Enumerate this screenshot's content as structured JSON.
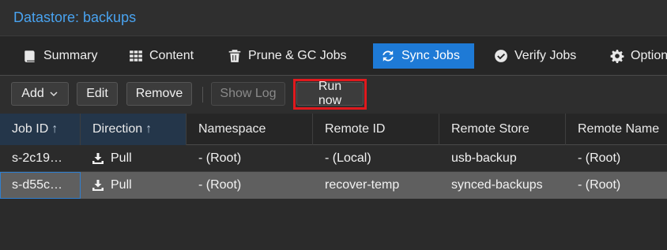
{
  "window": {
    "title": "Datastore: backups"
  },
  "tabs": [
    {
      "label": "Summary",
      "icon": "book-icon",
      "active": false
    },
    {
      "label": "Content",
      "icon": "grid-icon",
      "active": false
    },
    {
      "label": "Prune & GC Jobs",
      "icon": "trash-icon",
      "active": false
    },
    {
      "label": "Sync Jobs",
      "icon": "sync-icon",
      "active": true
    },
    {
      "label": "Verify Jobs",
      "icon": "check-circle-icon",
      "active": false
    },
    {
      "label": "Options",
      "icon": "gear-icon",
      "active": false
    }
  ],
  "toolbar": {
    "add_label": "Add",
    "edit_label": "Edit",
    "remove_label": "Remove",
    "show_log_label": "Show Log",
    "run_now_label": "Run now"
  },
  "grid": {
    "columns": [
      "Job ID",
      "Direction",
      "Namespace",
      "Remote ID",
      "Remote Store",
      "Remote Name"
    ],
    "rows": [
      {
        "job_id": "s-2c19…",
        "direction": "Pull",
        "namespace": "- (Root)",
        "remote_id": "- (Local)",
        "remote_store": "usb-backup",
        "remote_ns": "- (Root)"
      },
      {
        "job_id": "s-d55c…",
        "direction": "Pull",
        "namespace": "- (Root)",
        "remote_id": "recover-temp",
        "remote_store": "synced-backups",
        "remote_ns": "- (Root)"
      }
    ]
  },
  "colors": {
    "accent": "#1e7ad6",
    "title": "#49a3f0",
    "highlight": "#e0191d"
  }
}
